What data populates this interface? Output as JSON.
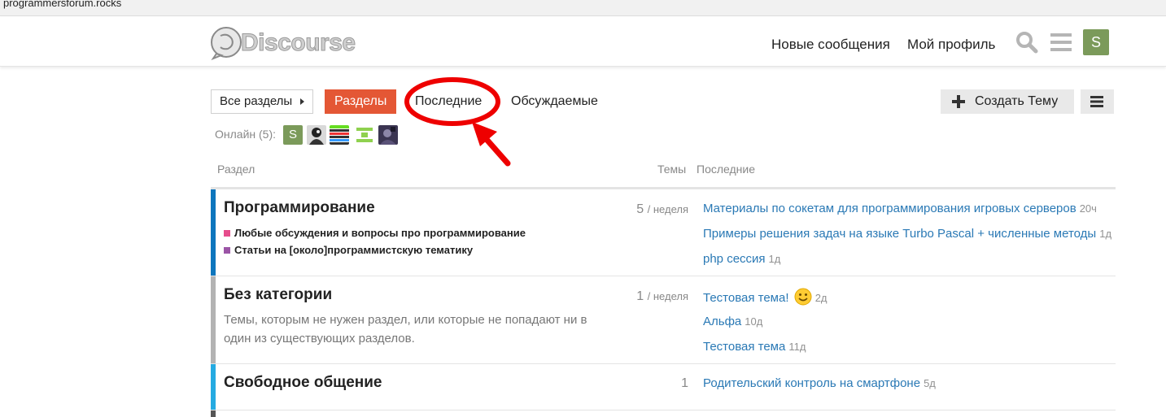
{
  "browser": {
    "url": "programmersforum.rocks"
  },
  "header": {
    "logo_text": "Discourse",
    "nav_new": "Новые сообщения",
    "nav_profile": "Мой профиль",
    "user_initial": "S",
    "accent": "#7b9a5a"
  },
  "toolbar": {
    "all_categories": "Все разделы",
    "tabs": [
      {
        "label": "Разделы",
        "active": true
      },
      {
        "label": "Последние",
        "active": false
      },
      {
        "label": "Обсуждаемые",
        "active": false
      }
    ],
    "create_topic": "Создать Тему",
    "active_color": "#e45735"
  },
  "online": {
    "label": "Онлайн (5):",
    "users": [
      "S",
      "",
      "",
      "",
      ""
    ]
  },
  "table": {
    "headers": {
      "category": "Раздел",
      "topics": "Темы",
      "latest": "Последние"
    },
    "rows": [
      {
        "name": "Программирование",
        "color": "#0e76bd",
        "count": "5",
        "period": "/ неделя",
        "subcategories": [
          {
            "name": "Любые обсуждения и вопросы про программирование",
            "color": "#e64d8c"
          },
          {
            "name": "Статьи на [около]программистскую тематику",
            "color": "#9b54a6"
          }
        ],
        "latest": [
          {
            "title": "Материалы по сокетам для программирования игровых серверов",
            "age": "20ч"
          },
          {
            "title": "Примеры решения задач на языке Turbo Pascal + численные методы",
            "age": "1д"
          },
          {
            "title": "php сессия",
            "age": "1д"
          }
        ]
      },
      {
        "name": "Без категории",
        "color": "#b3b3b3",
        "count": "1",
        "period": "/ неделя",
        "description": "Темы, которым не нужен раздел, или которые не попадают ни в один из существующих разделов.",
        "latest": [
          {
            "title": "Тестовая тема!",
            "age": "2д"
          },
          {
            "title": "Альфа",
            "age": "10д"
          },
          {
            "title": "Тестовая тема",
            "age": "11д"
          }
        ]
      },
      {
        "name": "Свободное общение",
        "color": "#25aae1",
        "count": "1",
        "period": "",
        "latest": [
          {
            "title": "Родительский контроль на смартфоне",
            "age": "5д"
          }
        ]
      }
    ]
  },
  "icons": [
    "search-icon",
    "hamburger-icon",
    "plus-icon",
    "caret-right-icon",
    "smiley-icon"
  ]
}
